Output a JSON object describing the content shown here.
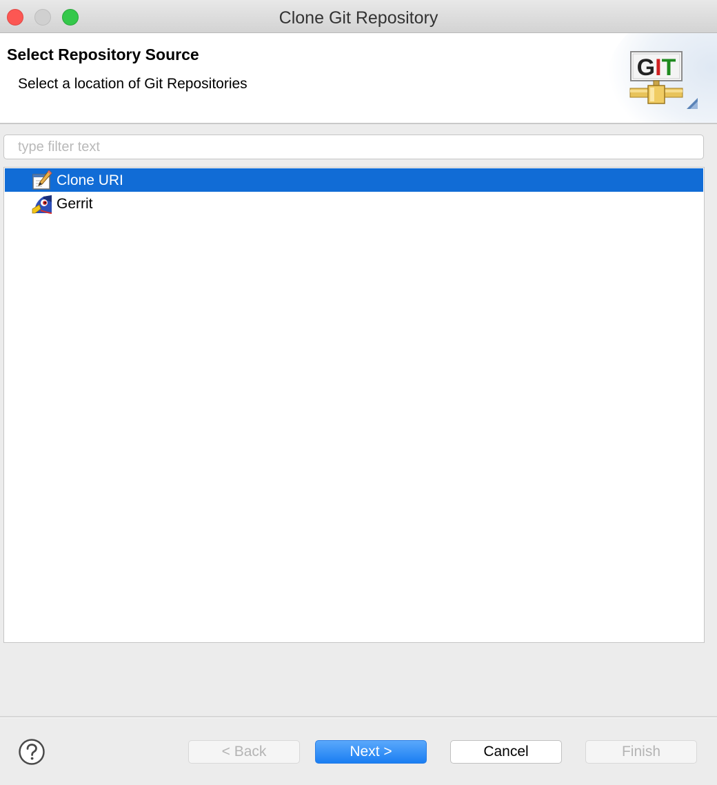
{
  "window": {
    "title": "Clone Git Repository"
  },
  "banner": {
    "title": "Select Repository Source",
    "description": "Select a location of Git Repositories",
    "logo_text": "GIT"
  },
  "filter": {
    "value": "",
    "placeholder": "type filter text"
  },
  "tree": {
    "items": [
      {
        "label": "Clone URI",
        "icon": "clone-uri-icon",
        "selected": true
      },
      {
        "label": "Gerrit",
        "icon": "gerrit-icon",
        "selected": false
      }
    ]
  },
  "footer": {
    "back_label": "< Back",
    "next_label": "Next >",
    "cancel_label": "Cancel",
    "finish_label": "Finish",
    "back_enabled": false,
    "next_enabled": true,
    "cancel_enabled": true,
    "finish_enabled": false
  },
  "colors": {
    "selection": "#116cd6",
    "default_button": "#1a7ef2",
    "close": "#fc5753",
    "maximize": "#34c84a"
  }
}
